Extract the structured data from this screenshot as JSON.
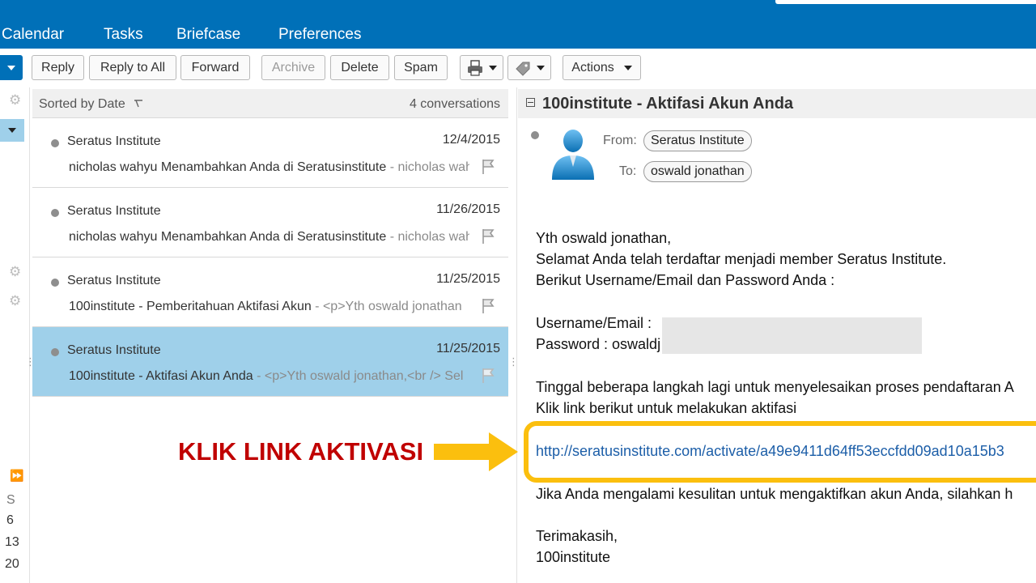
{
  "nav": {
    "tabs": [
      "Calendar",
      "Tasks",
      "Briefcase",
      "Preferences"
    ]
  },
  "toolbar": {
    "reply": "Reply",
    "reply_all": "Reply to All",
    "forward": "Forward",
    "archive": "Archive",
    "delete": "Delete",
    "spam": "Spam",
    "actions": "Actions"
  },
  "list": {
    "sort_label": "Sorted by Date",
    "count_label": "4 conversations",
    "items": [
      {
        "sender": "Seratus Institute",
        "date": "12/4/2015",
        "subject": "nicholas wahyu Menambahkan Anda di Seratusinstitute",
        "fragment": " - nicholas wahyu",
        "selected": false
      },
      {
        "sender": "Seratus Institute",
        "date": "11/26/2015",
        "subject": "nicholas wahyu Menambahkan Anda di Seratusinstitute",
        "fragment": " - nicholas wahyu",
        "selected": false
      },
      {
        "sender": "Seratus Institute",
        "date": "11/25/2015",
        "subject": "100institute - Pemberitahuan Aktifasi Akun",
        "fragment": " - <p>Yth oswald jonathan",
        "selected": false
      },
      {
        "sender": "Seratus Institute",
        "date": "11/25/2015",
        "subject": "100institute - Aktifasi Akun Anda",
        "fragment": " - <p>Yth oswald jonathan,<br /> Sel",
        "selected": true
      }
    ]
  },
  "mini_calendar": {
    "day_header": "S",
    "days": [
      "6",
      "13",
      "20"
    ]
  },
  "message": {
    "subject": "100institute - Aktifasi Akun Anda",
    "from_label": "From:",
    "from": "Seratus Institute",
    "to_label": "To:",
    "to": "oswald jonathan",
    "lines": {
      "l1": "Yth oswald jonathan,",
      "l2": "Selamat Anda telah terdaftar menjadi member Seratus Institute.",
      "l3": "Berikut Username/Email dan Password Anda :",
      "l4": "Username/Email : ",
      "l5": "Password : oswaldj",
      "l6": "Tinggal beberapa langkah lagi untuk menyelesaikan proses pendaftaran A",
      "l7": "Klik link berikut untuk melakukan aktifasi",
      "link": "http://seratusinstitute.com/activate/a49e9411d64ff53eccfdd09ad10a15b3",
      "l8": "Jika Anda mengalami kesulitan untuk mengaktifkan akun Anda, silahkan h",
      "l9": "Terimakasih,",
      "l10": "100institute"
    }
  },
  "annotation": {
    "text": "KLIK LINK AKTIVASI"
  },
  "colors": {
    "nav_blue": "#0070b8",
    "selected_row": "#9fd0ea",
    "link": "#1c5ea8",
    "highlight": "#fbbf0e",
    "annotation": "#c00000"
  }
}
